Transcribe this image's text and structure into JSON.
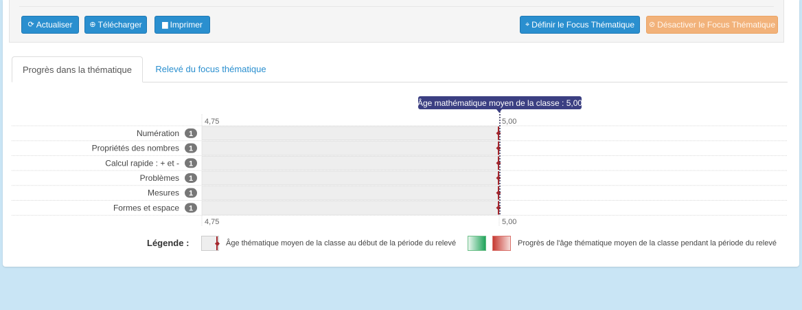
{
  "toolbar": {
    "refresh_label": "Actualiser",
    "download_label": "Télécharger",
    "print_label": "Imprimer",
    "define_focus_label": "Définir le Focus Thématique",
    "disable_focus_label": "Désactiver le Focus Thématique"
  },
  "icons": {
    "refresh": "refresh-icon",
    "download": "download-icon",
    "print": "print-icon",
    "crosshair": "crosshair-icon",
    "ban": "ban-icon"
  },
  "tabs": [
    {
      "label": "Progrès dans la thématique",
      "active": true
    },
    {
      "label": "Relevé du focus thématique",
      "active": false
    }
  ],
  "marker": {
    "label": "Âge mathématique moyen de la classe : 5,00",
    "value": 5.0
  },
  "chart_data": {
    "type": "bar",
    "orientation": "horizontal",
    "categories": [
      "Numération",
      "Propriétés des nombres",
      "Calcul rapide : + et -",
      "Problèmes",
      "Mesures",
      "Formes et espace"
    ],
    "counts": [
      1,
      1,
      1,
      1,
      1,
      1
    ],
    "values": [
      5.0,
      5.0,
      5.0,
      5.0,
      5.0,
      5.0
    ],
    "progress": [
      0,
      0,
      0,
      0,
      0,
      0
    ],
    "xlim": [
      4.75,
      5.25
    ],
    "x_ticks": [
      "4,75",
      "5,00"
    ],
    "reference_line": 5.0,
    "colors": {
      "bar": "#eeeeee",
      "start_marker": "#a4262c",
      "reference": "#2e2f5a",
      "gain": "#1fa35a",
      "loss": "#c63a33"
    }
  },
  "legend": {
    "title": "Légende :",
    "start_text": "Âge thématique moyen de la classe au début de la période du relevé",
    "progress_text": "Progrès de l'âge thématique moyen de la classe pendant la période du relevé"
  }
}
